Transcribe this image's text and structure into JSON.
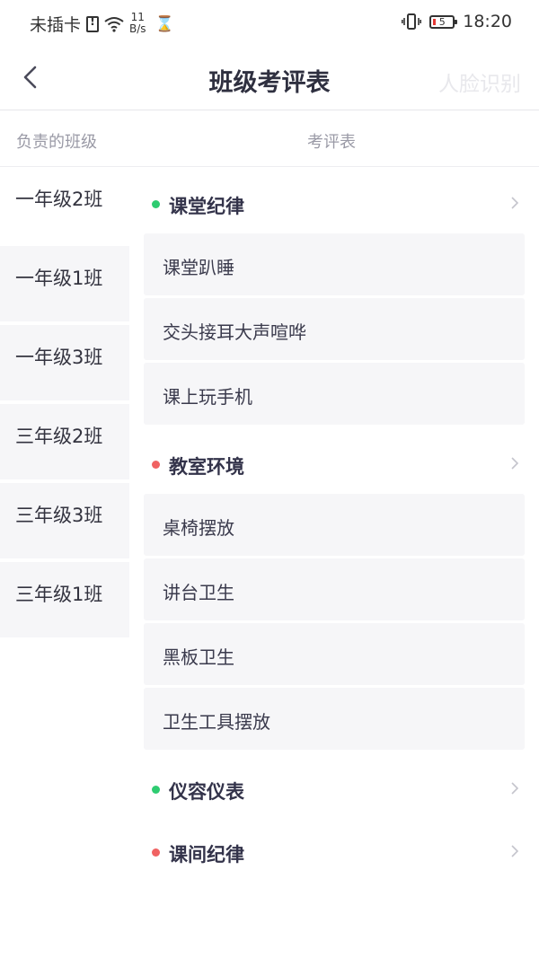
{
  "status_bar": {
    "carrier": "未插卡",
    "net_speed_value": "11",
    "net_speed_unit": "B/s",
    "battery_level": "5",
    "time": "18:20"
  },
  "nav": {
    "title": "班级考评表",
    "action": "人脸识别"
  },
  "columns": {
    "left": "负责的班级",
    "right": "考评表"
  },
  "classes": [
    {
      "label": "一年级2班"
    },
    {
      "label": "一年级1班"
    },
    {
      "label": "一年级3班"
    },
    {
      "label": "三年级2班"
    },
    {
      "label": "三年级3班"
    },
    {
      "label": "三年级1班"
    }
  ],
  "colors": {
    "green_dot": "#2ecc71",
    "red_dot": "#f06262",
    "item_bg": "#f6f6f8"
  },
  "sections": [
    {
      "title": "课堂纪律",
      "dot": "green",
      "items": [
        "课堂趴睡",
        "交头接耳大声喧哗",
        "课上玩手机"
      ]
    },
    {
      "title": "教室环境",
      "dot": "red",
      "items": [
        "桌椅摆放",
        "讲台卫生",
        "黑板卫生",
        "卫生工具摆放"
      ]
    },
    {
      "title": "仪容仪表",
      "dot": "green",
      "items": []
    },
    {
      "title": "课间纪律",
      "dot": "red",
      "items": []
    }
  ]
}
